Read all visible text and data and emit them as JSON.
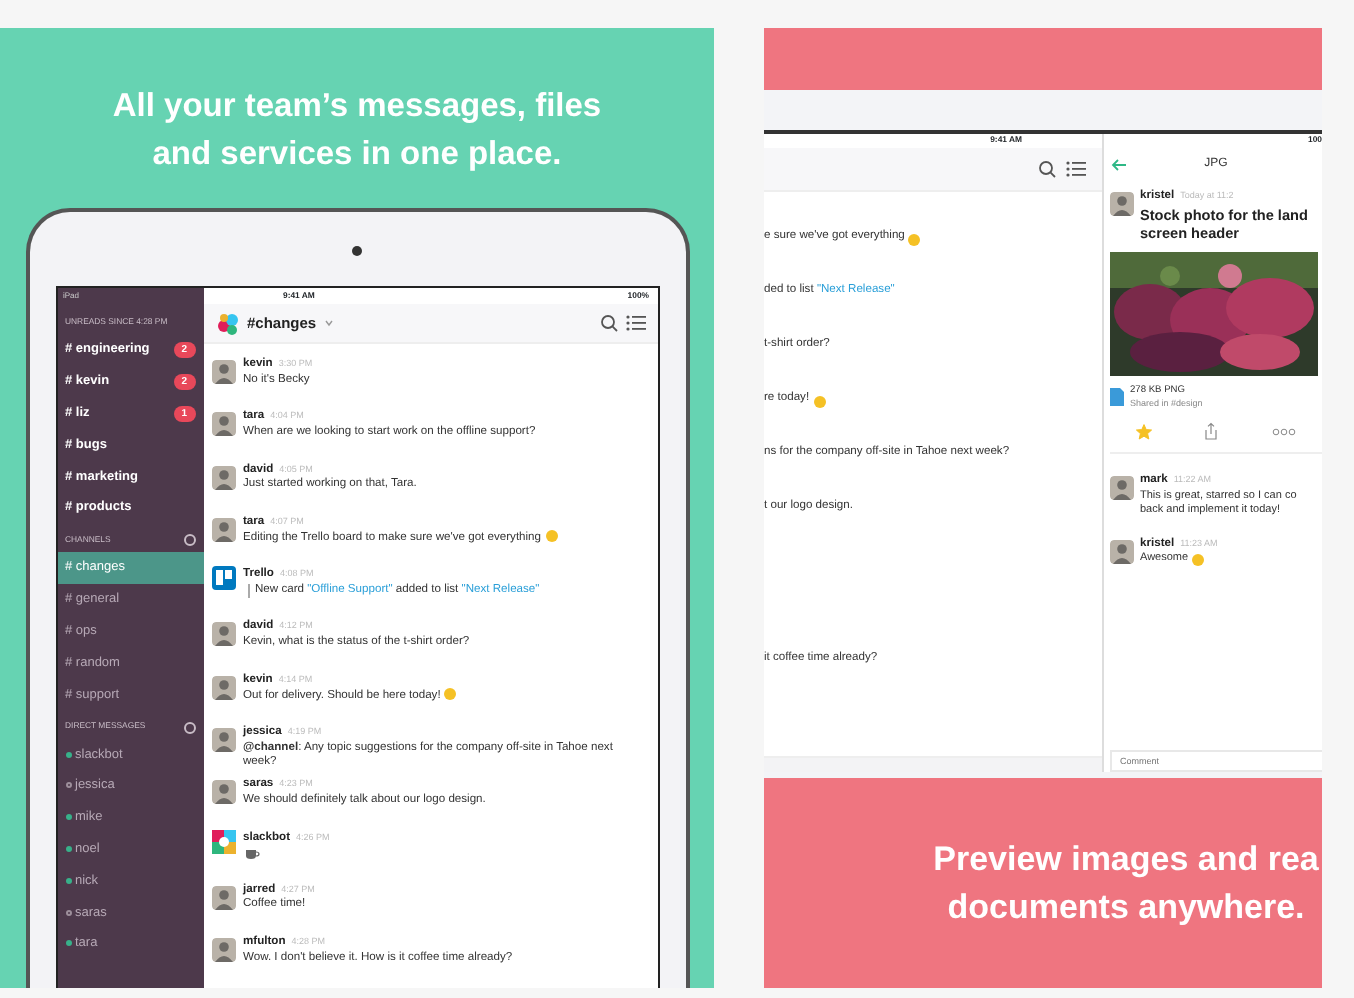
{
  "panels": [
    {
      "kind": "device-top",
      "headline": "All your team’s messages, files and services in one place.",
      "status": {
        "carrier": "iPad",
        "time": "9:41 AM",
        "battery": "100%"
      },
      "sidebar": {
        "unreads_title": "UNREADS SINCE 4:28 PM",
        "unreads": [
          {
            "label": "# engineering",
            "badge": "2"
          },
          {
            "label": "# kevin",
            "badge": "2"
          },
          {
            "label": "# liz",
            "badge": "1"
          },
          {
            "label": "# bugs"
          },
          {
            "label": "# marketing"
          },
          {
            "label": "# products"
          }
        ],
        "channels_title": "CHANNELS",
        "channels": [
          {
            "label": "# changes",
            "selected": true
          },
          {
            "label": "# general",
            "selected": false
          },
          {
            "label": "# ops",
            "selected": false
          },
          {
            "label": "# random",
            "selected": false
          },
          {
            "label": "# support",
            "selected": false
          }
        ],
        "dm_title": "DIRECT MESSAGES",
        "dms": [
          {
            "label": "slackbot",
            "online": true
          },
          {
            "label": "jessica",
            "online": false
          },
          {
            "label": "mike",
            "online": true
          },
          {
            "label": "noel",
            "online": true
          },
          {
            "label": "nick",
            "online": true
          },
          {
            "label": "saras",
            "online": false
          },
          {
            "label": "tara",
            "online": true
          }
        ]
      },
      "channel_title": "#changes",
      "messages": [
        {
          "kind": "text",
          "author": "kevin",
          "time": "3:30 PM",
          "text": "No it's Becky"
        },
        {
          "kind": "text",
          "author": "tara",
          "time": "4:04 PM",
          "text": "When are we looking to start work on the offline support?"
        },
        {
          "kind": "text",
          "author": "david",
          "time": "4:05 PM",
          "text": "Just started working on that, Tara."
        },
        {
          "kind": "text",
          "author": "tara",
          "time": "4:07 PM",
          "text": "Editing the Trello board to make sure we've got everything",
          "emoji": true
        },
        {
          "kind": "card",
          "author": "Trello",
          "time": "4:08 PM",
          "parts": [
            {
              "text": "New card "
            },
            {
              "text": "\"Offline Support\"",
              "link": true
            },
            {
              "text": " added to list "
            },
            {
              "text": "\"Next Release\"",
              "link": true
            }
          ]
        },
        {
          "kind": "text",
          "author": "david",
          "time": "4:12 PM",
          "text": "Kevin, what is the status of the t-shirt order?"
        },
        {
          "kind": "text",
          "author": "kevin",
          "time": "4:14 PM",
          "text": "Out for delivery. Should be here today!",
          "emoji": true
        },
        {
          "kind": "text",
          "author": "jessica",
          "time": "4:19 PM",
          "text": "**@channel**: Any topic suggestions for the company off-site in Tahoe next week?"
        },
        {
          "kind": "text",
          "author": "saras",
          "time": "4:23 PM",
          "text": "We should definitely talk about our logo design."
        },
        {
          "kind": "coffee",
          "author": "slackbot",
          "time": "4:26 PM"
        },
        {
          "kind": "text",
          "author": "jarred",
          "time": "4:27 PM",
          "text": "Coffee time!"
        },
        {
          "kind": "text",
          "author": "mfulton",
          "time": "4:28 PM",
          "text": "Wow. I don't believe it. How is it coffee time already?"
        }
      ]
    },
    {
      "kind": "device-bottom",
      "headline_lines": [
        "Preview images and rea",
        "documents anywhere."
      ],
      "status": {
        "time": "9:41 AM",
        "battery": "100"
      },
      "fragments": [
        {
          "text": "e sure we've got everything",
          "emoji": true
        },
        {
          "parts": [
            {
              "text": "ded to list "
            },
            {
              "text": "\"Next Release\"",
              "link": true
            }
          ]
        },
        {
          "text": "t-shirt order?"
        },
        {
          "text": "re today!",
          "emoji": true
        },
        {
          "text": "ns for the company off-site in Tahoe next week?"
        },
        {
          "text": "t our logo design."
        },
        {
          "text": "it coffee time already?",
          "late": true
        }
      ],
      "detail": {
        "title": "JPG",
        "author": "kristel",
        "time": "Today at 11:2",
        "file_title": "Stock photo for the land\nscreen header",
        "file_size": "278 KB PNG",
        "shared": "Shared in #design",
        "starred": true,
        "comments": [
          {
            "author": "mark",
            "time": "11:22 AM",
            "text": "This is great, starred so I can co\nback and implement it today!"
          },
          {
            "author": "kristel",
            "time": "11:23 AM",
            "text": "Awesome",
            "emoji": true
          }
        ],
        "placeholder": "Comment"
      }
    }
  ]
}
